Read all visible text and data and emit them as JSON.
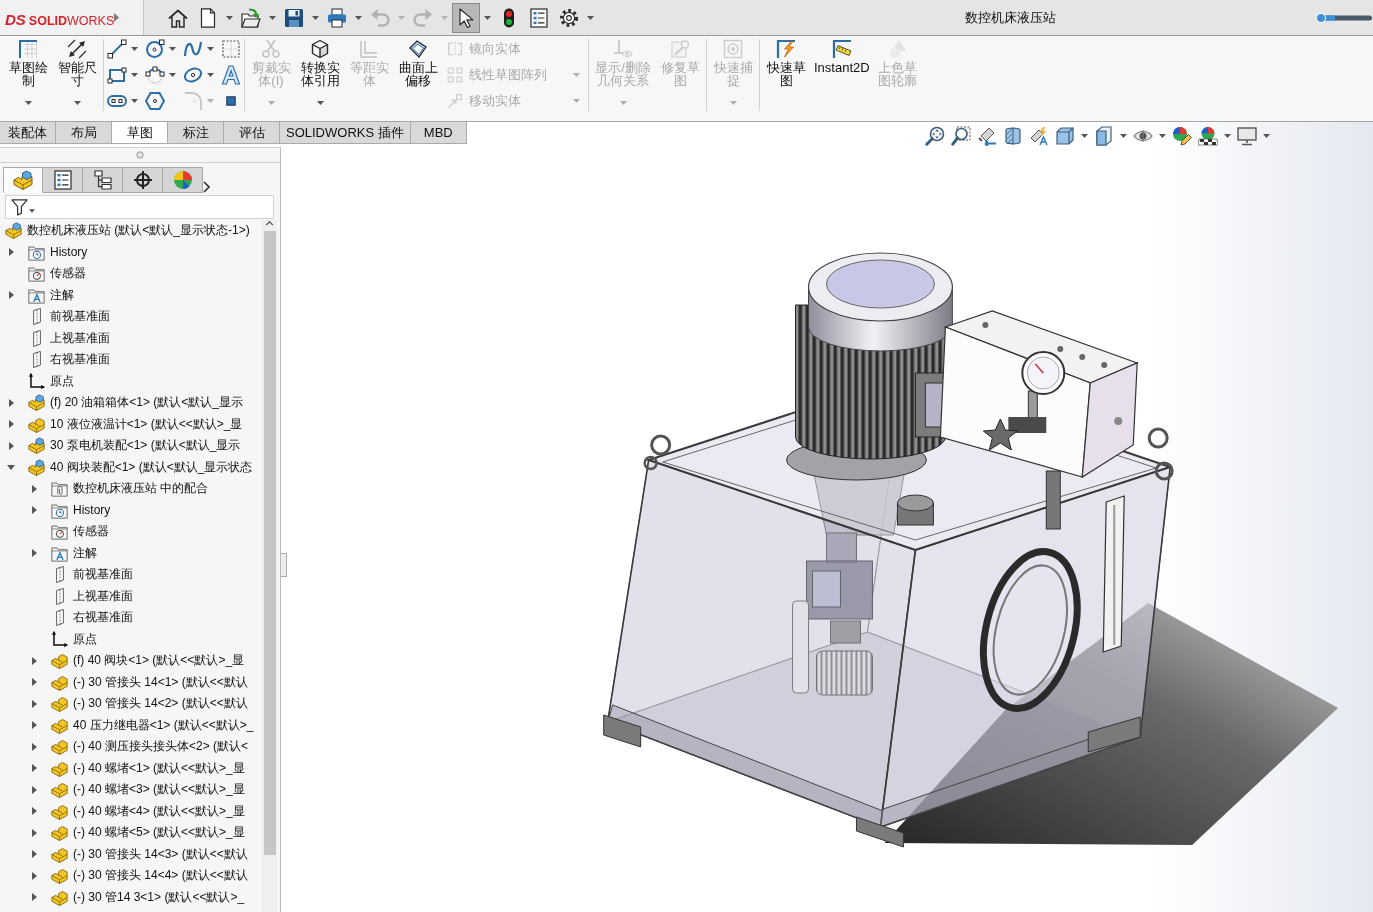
{
  "title_bar": {
    "logo": {
      "mark": "DS",
      "name": "**SOLID**WORKS"
    },
    "title": "数控机床液压站"
  },
  "quick_access_toolbar": [
    {
      "kind": "home",
      "dropdown": false,
      "disabled": false,
      "pressed": false
    },
    {
      "kind": "new",
      "dropdown": true,
      "disabled": false,
      "pressed": false
    },
    {
      "kind": "open",
      "dropdown": true,
      "disabled": false,
      "pressed": false
    },
    {
      "kind": "save",
      "dropdown": true,
      "disabled": false,
      "pressed": false
    },
    {
      "kind": "print",
      "dropdown": true,
      "disabled": false,
      "pressed": false
    },
    {
      "kind": "undo",
      "dropdown": true,
      "disabled": true,
      "pressed": false
    },
    {
      "kind": "redo",
      "dropdown": true,
      "disabled": true,
      "pressed": false
    },
    {
      "kind": "select",
      "dropdown": true,
      "disabled": false,
      "pressed": true
    },
    {
      "kind": "rebuild",
      "dropdown": false,
      "disabled": false,
      "pressed": false
    },
    {
      "kind": "file-properties",
      "dropdown": false,
      "disabled": false,
      "pressed": false
    },
    {
      "kind": "options",
      "dropdown": true,
      "disabled": false,
      "pressed": false
    }
  ],
  "command_manager": {
    "groups": [
      {
        "items": [
          {
            "kind": "sketch",
            "label": "草图绘制",
            "dropdown": true,
            "disabled": false
          },
          {
            "kind": "smart-dimension",
            "label": "智能尺寸",
            "dropdown": true,
            "disabled": false
          }
        ]
      },
      {
        "items": [
          {
            "kind": "line",
            "dropdown": true,
            "disabled": false
          },
          {
            "kind": "rectangle",
            "dropdown": true,
            "disabled": false
          },
          {
            "kind": "slot",
            "dropdown": true,
            "disabled": false
          },
          {
            "kind": "circle",
            "dropdown": true,
            "disabled": false
          },
          {
            "kind": "arc",
            "dropdown": true,
            "disabled": false
          },
          {
            "kind": "polygon",
            "dropdown": false,
            "disabled": false
          },
          {
            "kind": "spline",
            "dropdown": true,
            "disabled": false
          },
          {
            "kind": "ellipse",
            "dropdown": true,
            "disabled": false
          },
          {
            "kind": "fillet",
            "dropdown": true,
            "disabled": true
          },
          {
            "kind": "construction",
            "dropdown": false,
            "disabled": false
          },
          {
            "kind": "text",
            "dropdown": false,
            "disabled": false
          },
          {
            "kind": "point",
            "dropdown": false,
            "disabled": false
          }
        ]
      },
      {
        "items": [
          {
            "kind": "trim",
            "label": "剪裁实体(I)",
            "dropdown": true,
            "disabled": true
          },
          {
            "kind": "convert",
            "label": "转换实体引用",
            "dropdown": true,
            "disabled": false
          },
          {
            "kind": "offset",
            "label": "等距实体",
            "dropdown": false,
            "disabled": true
          },
          {
            "kind": "surface-offset",
            "label": "曲面上偏移",
            "dropdown": false,
            "disabled": false
          },
          {
            "kind": "mirror",
            "label": "镜向实体",
            "dropdown": false,
            "disabled": true
          },
          {
            "kind": "pattern",
            "label": "线性草图阵列",
            "dropdown": true,
            "disabled": true
          },
          {
            "kind": "move",
            "label": "移动实体",
            "dropdown": true,
            "disabled": true
          }
        ]
      },
      {
        "items": [
          {
            "kind": "relations",
            "label": "显示/删除几何关系",
            "dropdown": true,
            "disabled": true
          },
          {
            "kind": "repair",
            "label": "修复草图",
            "dropdown": false,
            "disabled": true
          }
        ]
      },
      {
        "items": [
          {
            "kind": "quick-snaps",
            "label": "快速捕捉",
            "dropdown": true,
            "disabled": true
          }
        ]
      },
      {
        "items": [
          {
            "kind": "rapid-sketch",
            "label": "快速草图",
            "dropdown": false,
            "disabled": false
          },
          {
            "kind": "instant2d",
            "label": "Instant2D",
            "dropdown": false,
            "disabled": false
          },
          {
            "kind": "shaded-contour",
            "label": "上色草图轮廓",
            "dropdown": false,
            "disabled": true
          }
        ]
      }
    ]
  },
  "tabs": [
    {
      "label": "装配体",
      "selected": false
    },
    {
      "label": "布局",
      "selected": false
    },
    {
      "label": "草图",
      "selected": true
    },
    {
      "label": "标注",
      "selected": false
    },
    {
      "label": "评估",
      "selected": false
    },
    {
      "label": "SOLIDWORKS 插件",
      "selected": false
    },
    {
      "label": "MBD",
      "selected": false
    }
  ],
  "view_toolbar": [
    {
      "kind": "zoom-fit",
      "dropdown": false
    },
    {
      "kind": "zoom-area",
      "dropdown": false
    },
    {
      "kind": "previous-view",
      "dropdown": false
    },
    {
      "kind": "section-view",
      "dropdown": false
    },
    {
      "kind": "dynamic-annotation",
      "dropdown": false
    },
    {
      "kind": "view-orientation",
      "dropdown": true
    },
    {
      "kind": "display-style",
      "dropdown": true
    },
    {
      "kind": "hide-show",
      "dropdown": true
    },
    {
      "kind": "edit-appearance",
      "dropdown": false
    },
    {
      "kind": "apply-scene",
      "dropdown": true
    },
    {
      "kind": "view-settings",
      "dropdown": true
    }
  ],
  "feature_manager": {
    "panel_tabs": [
      {
        "kind": "feature-manager",
        "selected": true
      },
      {
        "kind": "property-manager",
        "selected": false
      },
      {
        "kind": "configuration-manager",
        "selected": false
      },
      {
        "kind": "dimxpert-manager",
        "selected": false
      },
      {
        "kind": "display-manager",
        "selected": false
      }
    ],
    "tree": {
      "label": "数控机床液压站 (默认<默认_显示状态-1>)",
      "kind": "assembly",
      "children": [
        {
          "label": "History",
          "kind": "history",
          "expanded": false
        },
        {
          "label": "传感器",
          "kind": "sensors"
        },
        {
          "label": "注解",
          "kind": "annotations",
          "expanded": false
        },
        {
          "label": "前视基准面",
          "kind": "plane"
        },
        {
          "label": "上视基准面",
          "kind": "plane"
        },
        {
          "label": "右视基准面",
          "kind": "plane"
        },
        {
          "label": "原点",
          "kind": "origin"
        },
        {
          "label": "(f) 20 油箱箱体<1> (默认<默认_显示",
          "kind": "assembly",
          "expanded": false
        },
        {
          "label": "10 液位液温计<1> (默认<<默认>_显",
          "kind": "part",
          "expanded": false
        },
        {
          "label": "30 泵电机装配<1> (默认<默认_显示",
          "kind": "assembly",
          "expanded": false
        },
        {
          "label": "40 阀块装配<1> (默认<默认_显示状态",
          "kind": "assembly",
          "expanded": true,
          "children": [
            {
              "label": "数控机床液压站 中的配合",
              "kind": "mates",
              "expanded": false
            },
            {
              "label": "History",
              "kind": "history",
              "expanded": false
            },
            {
              "label": "传感器",
              "kind": "sensors"
            },
            {
              "label": "注解",
              "kind": "annotations",
              "expanded": false
            },
            {
              "label": "前视基准面",
              "kind": "plane"
            },
            {
              "label": "上视基准面",
              "kind": "plane"
            },
            {
              "label": "右视基准面",
              "kind": "plane"
            },
            {
              "label": "原点",
              "kind": "origin"
            },
            {
              "label": "(f) 40 阀块<1> (默认<<默认>_显",
              "kind": "part",
              "expanded": false
            },
            {
              "label": "(-) 30 管接头 14<1> (默认<<默认",
              "kind": "part",
              "expanded": false
            },
            {
              "label": "(-) 30 管接头 14<2> (默认<<默认",
              "kind": "part",
              "expanded": false
            },
            {
              "label": "40 压力继电器<1> (默认<<默认>_",
              "kind": "part",
              "expanded": false
            },
            {
              "label": "(-) 40 测压接头接头体<2> (默认<",
              "kind": "part",
              "expanded": false
            },
            {
              "label": "(-) 40 螺堵<1> (默认<<默认>_显",
              "kind": "part",
              "expanded": false
            },
            {
              "label": "(-) 40 螺堵<3> (默认<<默认>_显",
              "kind": "part",
              "expanded": false
            },
            {
              "label": "(-) 40 螺堵<4> (默认<<默认>_显",
              "kind": "part",
              "expanded": false
            },
            {
              "label": "(-) 40 螺堵<5> (默认<<默认>_显",
              "kind": "part",
              "expanded": false
            },
            {
              "label": "(-) 30 管接头 14<3> (默认<<默认",
              "kind": "part",
              "expanded": false
            },
            {
              "label": "(-) 30 管接头 14<4> (默认<<默认",
              "kind": "part",
              "expanded": false
            },
            {
              "label": "(-) 30 管14 3<1> (默认<<默认>_",
              "kind": "part",
              "expanded": false
            }
          ]
        }
      ]
    }
  }
}
